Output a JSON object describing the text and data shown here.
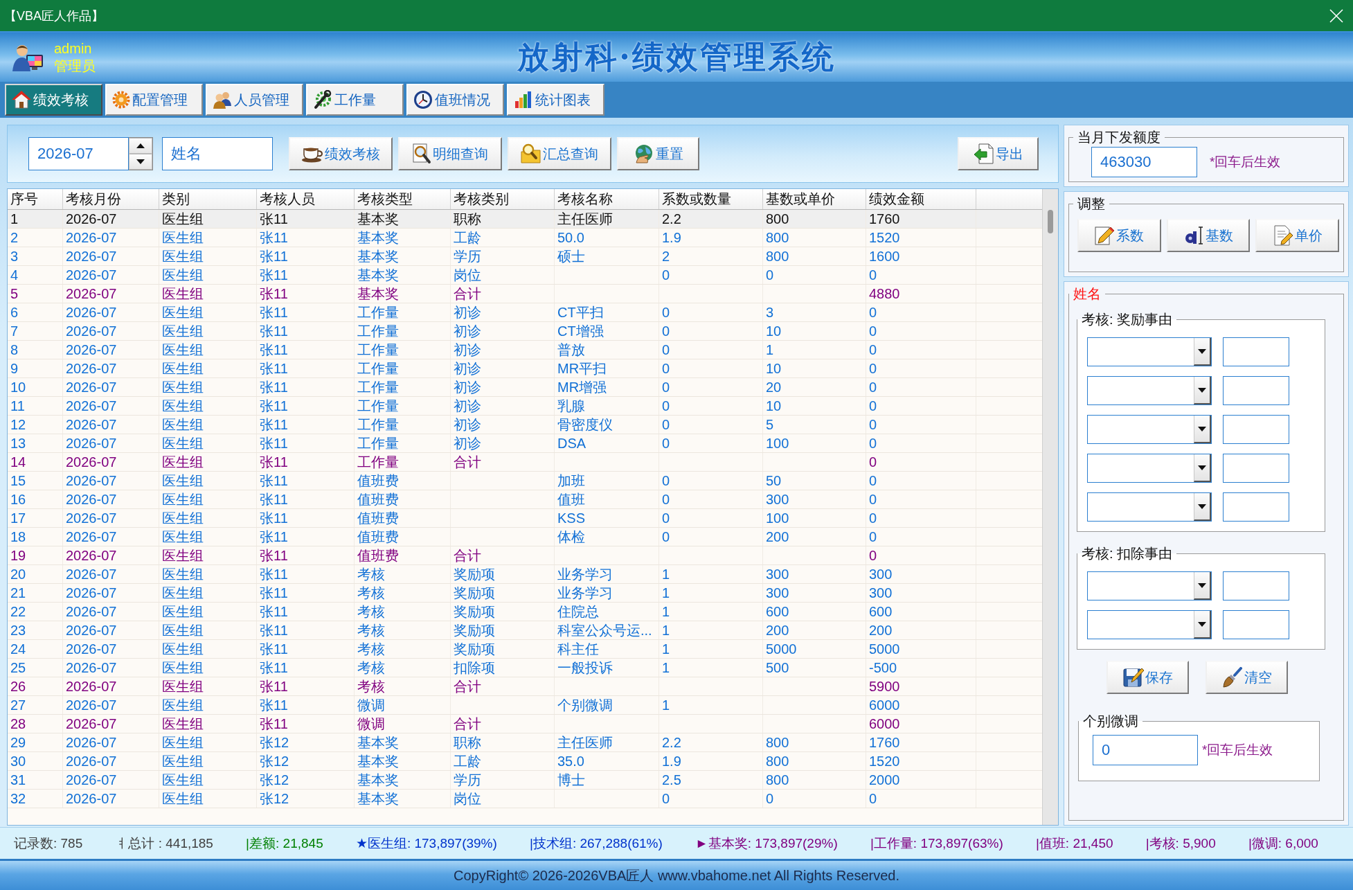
{
  "window": {
    "title": "【VBA匠人作品】"
  },
  "user": {
    "name": "admin",
    "role": "管理员"
  },
  "app_title": "放射科·绩效管理系统",
  "tabs": [
    {
      "label": "绩效考核",
      "selected": true
    },
    {
      "label": "配置管理",
      "selected": false
    },
    {
      "label": "人员管理",
      "selected": false
    },
    {
      "label": "工作量",
      "selected": false
    },
    {
      "label": "值班情况",
      "selected": false
    },
    {
      "label": "统计图表",
      "selected": false
    }
  ],
  "toolbar": {
    "month": {
      "value": "2026-07"
    },
    "name_field": {
      "value": "姓名"
    },
    "buttons": [
      "绩效考核",
      "明细查询",
      "汇总查询",
      "重置"
    ],
    "export_button": "导出"
  },
  "table": {
    "columns": [
      "序号",
      "考核月份",
      "类别",
      "考核人员",
      "考核类型",
      "考核类别",
      "考核名称",
      "系数或数量",
      "基数或单价",
      "绩效金额"
    ],
    "rows": [
      {
        "no": "1",
        "month": "2026-07",
        "group": "医生组",
        "staff": "张11",
        "type": "基本奖",
        "category": "职称",
        "item": "主任医师",
        "qty": "2.2",
        "base": "800",
        "amount": "1760",
        "kind": "item",
        "selected": true
      },
      {
        "no": "2",
        "month": "2026-07",
        "group": "医生组",
        "staff": "张11",
        "type": "基本奖",
        "category": "工龄",
        "item": "50.0",
        "qty": "1.9",
        "base": "800",
        "amount": "1520",
        "kind": "item",
        "selected": false
      },
      {
        "no": "3",
        "month": "2026-07",
        "group": "医生组",
        "staff": "张11",
        "type": "基本奖",
        "category": "学历",
        "item": "硕士",
        "qty": "2",
        "base": "800",
        "amount": "1600",
        "kind": "item",
        "selected": false
      },
      {
        "no": "4",
        "month": "2026-07",
        "group": "医生组",
        "staff": "张11",
        "type": "基本奖",
        "category": "岗位",
        "qty": "0",
        "base": "0",
        "amount": "0",
        "kind": "item",
        "selected": false
      },
      {
        "no": "5",
        "month": "2026-07",
        "group": "医生组",
        "staff": "张11",
        "type": "基本奖",
        "category": "合计",
        "amount": "4880",
        "kind": "total",
        "selected": false
      },
      {
        "no": "6",
        "month": "2026-07",
        "group": "医生组",
        "staff": "张11",
        "type": "工作量",
        "category": "初诊",
        "item": "CT平扫",
        "qty": "0",
        "base": "3",
        "amount": "0",
        "kind": "item",
        "selected": false
      },
      {
        "no": "7",
        "month": "2026-07",
        "group": "医生组",
        "staff": "张11",
        "type": "工作量",
        "category": "初诊",
        "item": "CT增强",
        "qty": "0",
        "base": "10",
        "amount": "0",
        "kind": "item",
        "selected": false
      },
      {
        "no": "8",
        "month": "2026-07",
        "group": "医生组",
        "staff": "张11",
        "type": "工作量",
        "category": "初诊",
        "item": "普放",
        "qty": "0",
        "base": "1",
        "amount": "0",
        "kind": "item",
        "selected": false
      },
      {
        "no": "9",
        "month": "2026-07",
        "group": "医生组",
        "staff": "张11",
        "type": "工作量",
        "category": "初诊",
        "item": "MR平扫",
        "qty": "0",
        "base": "10",
        "amount": "0",
        "kind": "item",
        "selected": false
      },
      {
        "no": "10",
        "month": "2026-07",
        "group": "医生组",
        "staff": "张11",
        "type": "工作量",
        "category": "初诊",
        "item": "MR增强",
        "qty": "0",
        "base": "20",
        "amount": "0",
        "kind": "item",
        "selected": false
      },
      {
        "no": "11",
        "month": "2026-07",
        "group": "医生组",
        "staff": "张11",
        "type": "工作量",
        "category": "初诊",
        "item": "乳腺",
        "qty": "0",
        "base": "10",
        "amount": "0",
        "kind": "item",
        "selected": false
      },
      {
        "no": "12",
        "month": "2026-07",
        "group": "医生组",
        "staff": "张11",
        "type": "工作量",
        "category": "初诊",
        "item": "骨密度仪",
        "qty": "0",
        "base": "5",
        "amount": "0",
        "kind": "item",
        "selected": false
      },
      {
        "no": "13",
        "month": "2026-07",
        "group": "医生组",
        "staff": "张11",
        "type": "工作量",
        "category": "初诊",
        "item": "DSA",
        "qty": "0",
        "base": "100",
        "amount": "0",
        "kind": "item",
        "selected": false
      },
      {
        "no": "14",
        "month": "2026-07",
        "group": "医生组",
        "staff": "张11",
        "type": "工作量",
        "category": "合计",
        "amount": "0",
        "kind": "total",
        "selected": false
      },
      {
        "no": "15",
        "month": "2026-07",
        "group": "医生组",
        "staff": "张11",
        "type": "值班费",
        "item": "加班",
        "qty": "0",
        "base": "50",
        "amount": "0",
        "kind": "item",
        "selected": false
      },
      {
        "no": "16",
        "month": "2026-07",
        "group": "医生组",
        "staff": "张11",
        "type": "值班费",
        "item": "值班",
        "qty": "0",
        "base": "300",
        "amount": "0",
        "kind": "item",
        "selected": false
      },
      {
        "no": "17",
        "month": "2026-07",
        "group": "医生组",
        "staff": "张11",
        "type": "值班费",
        "item": "KSS",
        "qty": "0",
        "base": "100",
        "amount": "0",
        "kind": "item",
        "selected": false
      },
      {
        "no": "18",
        "month": "2026-07",
        "group": "医生组",
        "staff": "张11",
        "type": "值班费",
        "item": "体检",
        "qty": "0",
        "base": "200",
        "amount": "0",
        "kind": "item",
        "selected": false
      },
      {
        "no": "19",
        "month": "2026-07",
        "group": "医生组",
        "staff": "张11",
        "type": "值班费",
        "category": "合计",
        "amount": "0",
        "kind": "total",
        "selected": false
      },
      {
        "no": "20",
        "month": "2026-07",
        "group": "医生组",
        "staff": "张11",
        "type": "考核",
        "category": "奖励项",
        "item": "业务学习",
        "qty": "1",
        "base": "300",
        "amount": "300",
        "kind": "item",
        "selected": false
      },
      {
        "no": "21",
        "month": "2026-07",
        "group": "医生组",
        "staff": "张11",
        "type": "考核",
        "category": "奖励项",
        "item": "业务学习",
        "qty": "1",
        "base": "300",
        "amount": "300",
        "kind": "item",
        "selected": false
      },
      {
        "no": "22",
        "month": "2026-07",
        "group": "医生组",
        "staff": "张11",
        "type": "考核",
        "category": "奖励项",
        "item": "住院总",
        "qty": "1",
        "base": "600",
        "amount": "600",
        "kind": "item",
        "selected": false
      },
      {
        "no": "23",
        "month": "2026-07",
        "group": "医生组",
        "staff": "张11",
        "type": "考核",
        "category": "奖励项",
        "item": "科室公众号运...",
        "qty": "1",
        "base": "200",
        "amount": "200",
        "kind": "item",
        "selected": false
      },
      {
        "no": "24",
        "month": "2026-07",
        "group": "医生组",
        "staff": "张11",
        "type": "考核",
        "category": "奖励项",
        "item": "科主任",
        "qty": "1",
        "base": "5000",
        "amount": "5000",
        "kind": "item",
        "selected": false
      },
      {
        "no": "25",
        "month": "2026-07",
        "group": "医生组",
        "staff": "张11",
        "type": "考核",
        "category": "扣除项",
        "item": "一般投诉",
        "qty": "1",
        "base": "500",
        "amount": "-500",
        "kind": "item",
        "selected": false
      },
      {
        "no": "26",
        "month": "2026-07",
        "group": "医生组",
        "staff": "张11",
        "type": "考核",
        "category": "合计",
        "amount": "5900",
        "kind": "total",
        "selected": false
      },
      {
        "no": "27",
        "month": "2026-07",
        "group": "医生组",
        "staff": "张11",
        "type": "微调",
        "item": "个别微调",
        "qty": "1",
        "amount": "6000",
        "kind": "item",
        "selected": false
      },
      {
        "no": "28",
        "month": "2026-07",
        "group": "医生组",
        "staff": "张11",
        "type": "微调",
        "category": "合计",
        "amount": "6000",
        "kind": "total",
        "selected": false
      },
      {
        "no": "29",
        "month": "2026-07",
        "group": "医生组",
        "staff": "张12",
        "type": "基本奖",
        "category": "职称",
        "item": "主任医师",
        "qty": "2.2",
        "base": "800",
        "amount": "1760",
        "kind": "item",
        "selected": false
      },
      {
        "no": "30",
        "month": "2026-07",
        "group": "医生组",
        "staff": "张12",
        "type": "基本奖",
        "category": "工龄",
        "item": "35.0",
        "qty": "1.9",
        "base": "800",
        "amount": "1520",
        "kind": "item",
        "selected": false
      },
      {
        "no": "31",
        "month": "2026-07",
        "group": "医生组",
        "staff": "张12",
        "type": "基本奖",
        "category": "学历",
        "item": "博士",
        "qty": "2.5",
        "base": "800",
        "amount": "2000",
        "kind": "item",
        "selected": false
      },
      {
        "no": "32",
        "month": "2026-07",
        "group": "医生组",
        "staff": "张12",
        "type": "基本奖",
        "category": "岗位",
        "qty": "0",
        "base": "0",
        "amount": "0",
        "kind": "item",
        "selected": false
      }
    ]
  },
  "quota": {
    "title": "当月下发额度",
    "value": "463030",
    "hint": "*回车后生效"
  },
  "adjust": {
    "title": "调整",
    "buttons": [
      "系数",
      "基数",
      "单价"
    ]
  },
  "person_panel": {
    "title": "姓名",
    "reward": {
      "title": "考核: 奖励事由",
      "rows": [
        {},
        {},
        {},
        {},
        {}
      ]
    },
    "deduction": {
      "title": "考核: 扣除事由",
      "rows": [
        {},
        {}
      ]
    },
    "buttons": [
      "保存",
      "清空"
    ],
    "fine_tune": {
      "title": "个别微调",
      "value": "0",
      "hint": "*回车后生效"
    }
  },
  "status_bar": [
    {
      "text": "记录数: 785",
      "color": "#404040"
    },
    {
      "text": "ㅕ总计 : 441,185",
      "color": "#404040"
    },
    {
      "text": "|差额: 21,845",
      "color": "#008000"
    },
    {
      "text": "★医生组: 173,897(39%)",
      "color": "#0033cc"
    },
    {
      "text": "|技术组: 267,288(61%)",
      "color": "#0033cc"
    },
    {
      "text": "►基本奖: 173,897(29%)",
      "color": "#800080"
    },
    {
      "text": "|工作量: 173,897(63%)",
      "color": "#800080"
    },
    {
      "text": "|值班: 21,450",
      "color": "#800080"
    },
    {
      "text": "|考核: 5,900",
      "color": "#800080"
    },
    {
      "text": "|微调: 6,000",
      "color": "#800080"
    }
  ],
  "footer": "CopyRight© 2026-2026VBA匠人 www.vbahome.net All Rights Reserved."
}
